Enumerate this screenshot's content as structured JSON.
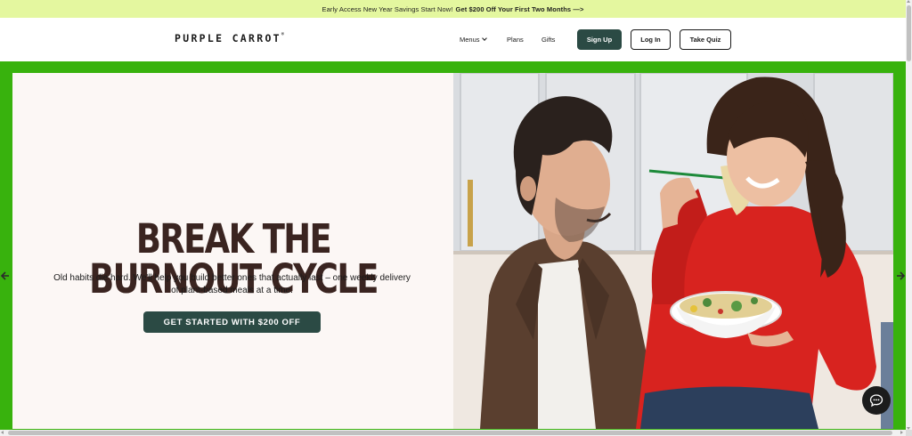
{
  "announcement": {
    "text": "Early Access New Year Savings Start Now!",
    "offer": "Get $200 Off Your First Two Months —>"
  },
  "header": {
    "logo": "PURPLE CARROT",
    "logo_mark": "®",
    "nav": {
      "menus": "Menus",
      "plans": "Plans",
      "gifts": "Gifts"
    },
    "signup": "Sign Up",
    "login": "Log In",
    "quiz": "Take Quiz"
  },
  "hero": {
    "title": "BREAK THE BURNOUT CYCLE",
    "subtitle": "Old habits die hard. We'll help you build better ones that actually last – one weekly delivery of plant-based meals at a time.",
    "cta": "GET STARTED WITH $200 OFF"
  },
  "colors": {
    "announcement_bg": "#e4f79f",
    "brand_green_dark": "#2b4a44",
    "highlight_border": "#38b20d",
    "hero_bg": "#fcf7f5",
    "title_brown": "#3a2420"
  },
  "icons": {
    "prev": "arrow-left-icon",
    "next": "arrow-right-icon",
    "chat": "chat-bubble-icon",
    "menus_caret": "chevron-down-icon"
  }
}
